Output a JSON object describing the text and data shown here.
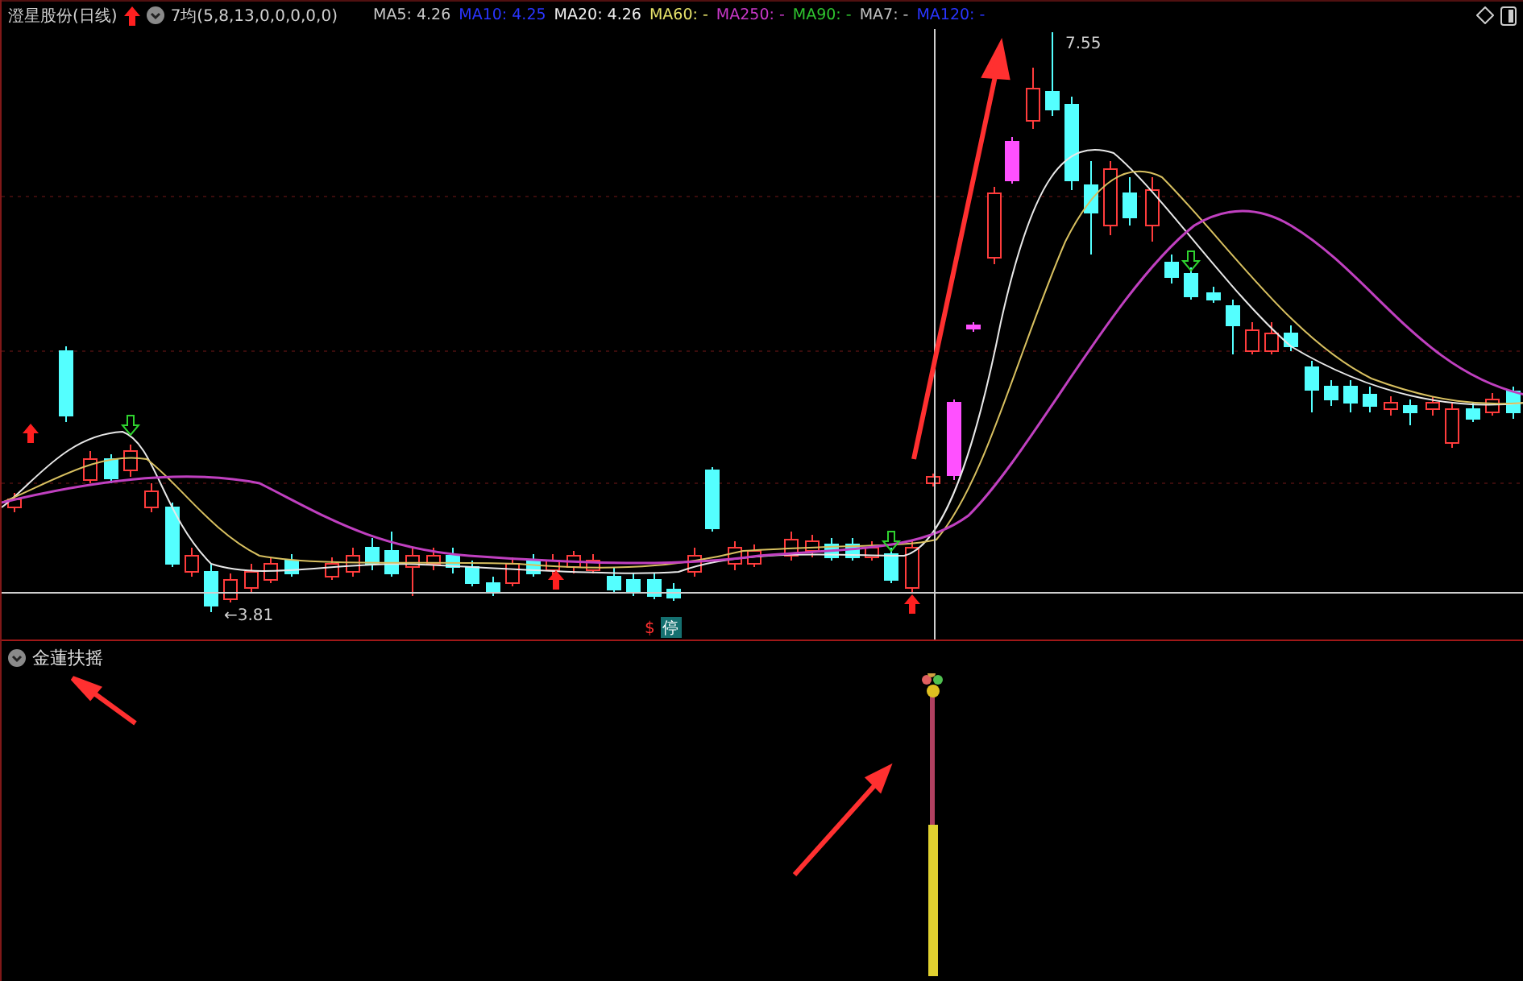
{
  "header": {
    "title": "澄星股份(日线)",
    "indicator": "7均(5,8,13,0,0,0,0,0)"
  },
  "legend": [
    {
      "label": "MA5:",
      "value": "4.26",
      "color": "#c8c8c8"
    },
    {
      "label": "MA10:",
      "value": "4.25",
      "color": "#2a35ff"
    },
    {
      "label": "MA20:",
      "value": "4.26",
      "color": "#f0f0f0"
    },
    {
      "label": "MA60:",
      "value": "-",
      "color": "#e6e26a"
    },
    {
      "label": "MA250:",
      "value": "-",
      "color": "#c838c8"
    },
    {
      "label": "MA90:",
      "value": "-",
      "color": "#2fc42f"
    },
    {
      "label": "MA7:",
      "value": "-",
      "color": "#c0c0c0"
    },
    {
      "label": "MA120:",
      "value": "-",
      "color": "#2a35ff"
    }
  ],
  "chart": {
    "high_label": "7.55",
    "low_label": "←3.81",
    "signal_mark": "$",
    "halt_badge": "停"
  },
  "panel": {
    "title": "金蓮扶摇"
  }
}
